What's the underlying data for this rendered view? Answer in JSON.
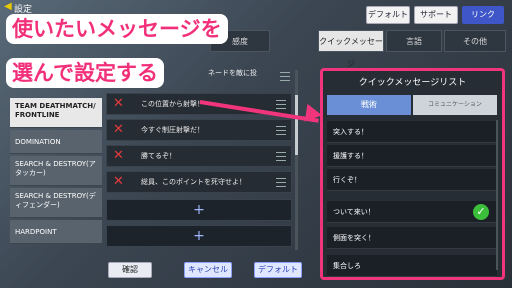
{
  "header": {
    "back_icon": "back-arrow-icon",
    "title": "設定",
    "buttons": [
      {
        "label": "デフォルト",
        "active": false
      },
      {
        "label": "サポート",
        "active": false
      },
      {
        "label": "リンク",
        "active": true
      }
    ]
  },
  "tabs": [
    {
      "label": "感度",
      "active": false
    },
    {
      "label": "クイックメッセージ",
      "active": true
    },
    {
      "label": "言語",
      "active": false
    },
    {
      "label": "その他",
      "active": false
    }
  ],
  "partial_text": "ネードを敵に投",
  "modes": [
    {
      "label": "TEAM DEATHMATCH/ FRONTLINE",
      "active": true
    },
    {
      "label": "DOMINATION",
      "active": false
    },
    {
      "label": "SEARCH & DESTROY(アタッカー)",
      "active": false
    },
    {
      "label": "SEARCH & DESTROY(ディフェンダー)",
      "active": false
    },
    {
      "label": "HARDPOINT",
      "active": false
    }
  ],
  "messages": [
    "この位置から射撃！",
    "今すぐ制圧射撃だ！",
    "勝てるぞ！",
    "総員、このポイントを死守せよ！"
  ],
  "add_label": "+",
  "bottom_buttons": {
    "confirm": "確認",
    "cancel": "キャンセル",
    "default": "デフォルト"
  },
  "quick_panel": {
    "title": "クイックメッセージリスト",
    "tabs": [
      {
        "label": "戦術",
        "active": true
      },
      {
        "label": "コミュニケーション",
        "active": false
      }
    ],
    "items": [
      {
        "label": "突入する！",
        "checked": false
      },
      {
        "label": "援護する！",
        "checked": false
      },
      {
        "label": "行くぞ！",
        "checked": false
      },
      {
        "label": "ついて来い！",
        "checked": true
      },
      {
        "label": "側面を突く！",
        "checked": false
      },
      {
        "label": "集合しろ",
        "checked": false
      }
    ]
  },
  "annotations": {
    "line1": "使いたいメッセージを",
    "line2": "選んで設定する"
  },
  "colors": {
    "accent_pink": "#f0357d",
    "active_blue": "#3e56c8",
    "tab_blue": "#6b8fd6",
    "delete_red": "#e33a3a",
    "check_green": "#3bbf3b"
  }
}
